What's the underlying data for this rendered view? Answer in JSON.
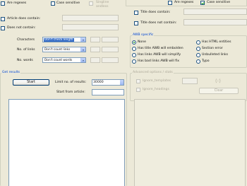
{
  "left": {
    "any_regexes": "Are regexes",
    "case_sensitive": "Case sensitive",
    "singleline_line1": "Singline",
    "singleline_line2": "andless",
    "article_contains": "Article does contain:",
    "does_not_contain": "Does not contain:",
    "characters_label": "Characters",
    "characters_value": "Don't check length",
    "links_label": "No. of links",
    "links_value": "Don't count links",
    "words_label": "No. words",
    "words_value": "Don't count words"
  },
  "right": {
    "any_regexes": "Are regexes",
    "case_sensitive": "Case sensitive",
    "title_contains": "Title does contain:",
    "title_not_contains": "Title does not contain:"
  },
  "awb": {
    "title": "AWB specific",
    "options": [
      {
        "label": "None",
        "selected": true
      },
      {
        "label": "Has HTML entities",
        "selected": false
      },
      {
        "label": "Has title AWB will embolden",
        "selected": false
      },
      {
        "label": "Section error",
        "selected": false
      },
      {
        "label": "Has links AWB will simplify",
        "selected": false
      },
      {
        "label": "Unbulleted links",
        "selected": false
      },
      {
        "label": "Has bad links AWB will fix",
        "selected": false
      },
      {
        "label": "Typo",
        "selected": false
      }
    ]
  },
  "results": {
    "title": "Get results",
    "start": "Start",
    "limit_label": "Limit no. of results:",
    "limit_value": "30000",
    "start_from_label": "Start from article:"
  },
  "adv": {
    "title": "Advanced options / stats",
    "checkbox1": "Ignore_templates",
    "checkbox2": "Ignore_headings",
    "clear": "Clear"
  }
}
